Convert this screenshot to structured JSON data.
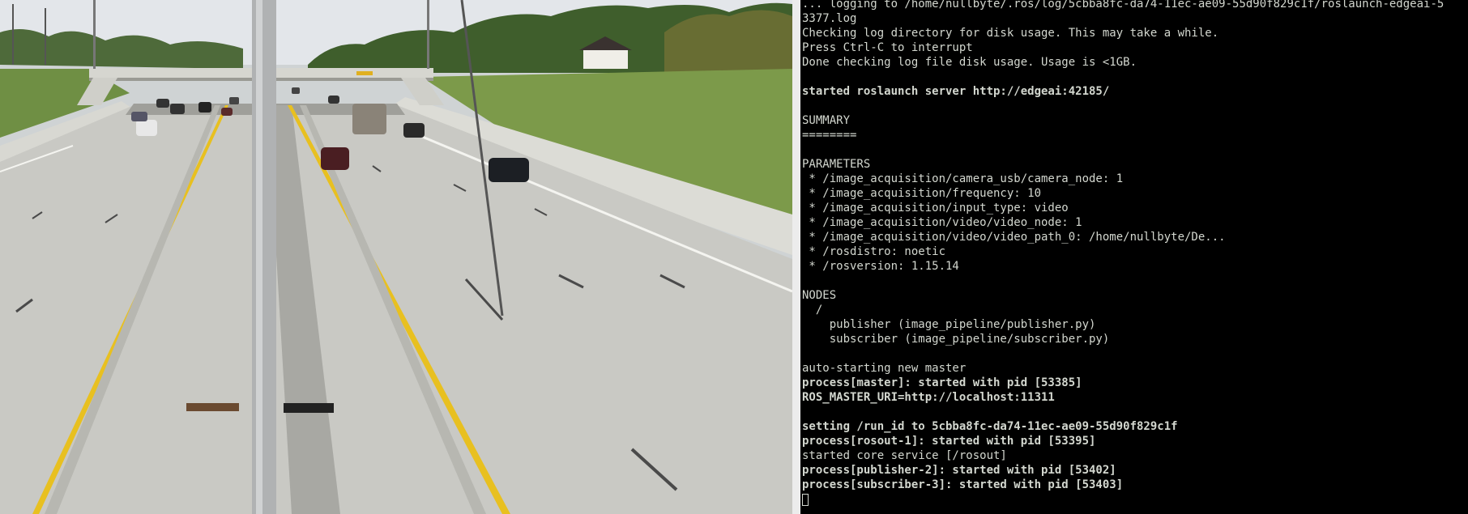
{
  "video": {
    "scene": "overhead-highway-camera-feed"
  },
  "terminal": {
    "lines": [
      {
        "text": "... logging to /home/nullbyte/.ros/log/5cbba8fc-da74-11ec-ae09-55d90f829c1f/roslaunch-edgeai-5",
        "bold": false
      },
      {
        "text": "3377.log",
        "bold": false
      },
      {
        "text": "Checking log directory for disk usage. This may take a while.",
        "bold": false
      },
      {
        "text": "Press Ctrl-C to interrupt",
        "bold": false
      },
      {
        "text": "Done checking log file disk usage. Usage is <1GB.",
        "bold": false
      },
      {
        "text": "",
        "bold": false
      },
      {
        "text": "started roslaunch server http://edgeai:42185/",
        "bold": true
      },
      {
        "text": "",
        "bold": false
      },
      {
        "text": "SUMMARY",
        "bold": false
      },
      {
        "text": "========",
        "bold": false
      },
      {
        "text": "",
        "bold": false
      },
      {
        "text": "PARAMETERS",
        "bold": false
      },
      {
        "text": " * /image_acquisition/camera_usb/camera_node: 1",
        "bold": false
      },
      {
        "text": " * /image_acquisition/frequency: 10",
        "bold": false
      },
      {
        "text": " * /image_acquisition/input_type: video",
        "bold": false
      },
      {
        "text": " * /image_acquisition/video/video_node: 1",
        "bold": false
      },
      {
        "text": " * /image_acquisition/video/video_path_0: /home/nullbyte/De...",
        "bold": false
      },
      {
        "text": " * /rosdistro: noetic",
        "bold": false
      },
      {
        "text": " * /rosversion: 1.15.14",
        "bold": false
      },
      {
        "text": "",
        "bold": false
      },
      {
        "text": "NODES",
        "bold": false
      },
      {
        "text": "  /",
        "bold": false
      },
      {
        "text": "    publisher (image_pipeline/publisher.py)",
        "bold": false
      },
      {
        "text": "    subscriber (image_pipeline/subscriber.py)",
        "bold": false
      },
      {
        "text": "",
        "bold": false
      },
      {
        "text": "auto-starting new master",
        "bold": false
      },
      {
        "text": "process[master]: started with pid [53385]",
        "bold": true
      },
      {
        "text": "ROS_MASTER_URI=http://localhost:11311",
        "bold": true
      },
      {
        "text": "",
        "bold": false
      },
      {
        "text": "setting /run_id to 5cbba8fc-da74-11ec-ae09-55d90f829c1f",
        "bold": true
      },
      {
        "text": "process[rosout-1]: started with pid [53395]",
        "bold": true
      },
      {
        "text": "started core service [/rosout]",
        "bold": false
      },
      {
        "text": "process[publisher-2]: started with pid [53402]",
        "bold": true
      },
      {
        "text": "process[subscriber-3]: started with pid [53403]",
        "bold": true
      }
    ]
  },
  "colors": {
    "terminal_bg": "#000000",
    "terminal_fg": "#d3d7cf",
    "lane_line": "#e8c020",
    "road": "#c9c9c4",
    "grass": "#7c9a4a",
    "sky": "#e3e6ea"
  }
}
